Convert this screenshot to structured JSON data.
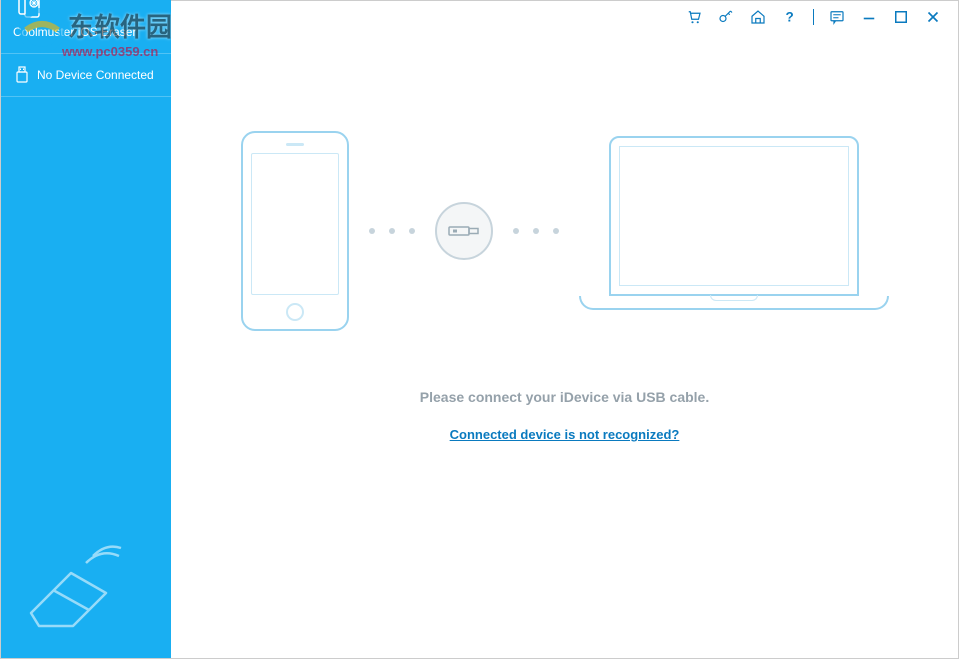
{
  "app": {
    "title": "Coolmuster iOS Eraser"
  },
  "sidebar": {
    "device_status": "No Device Connected"
  },
  "main": {
    "prompt": "Please connect your iDevice via USB cable.",
    "help_link": "Connected device is not recognized?"
  },
  "watermark": {
    "text": "东软件园",
    "url": "www.pc0359.cn"
  }
}
